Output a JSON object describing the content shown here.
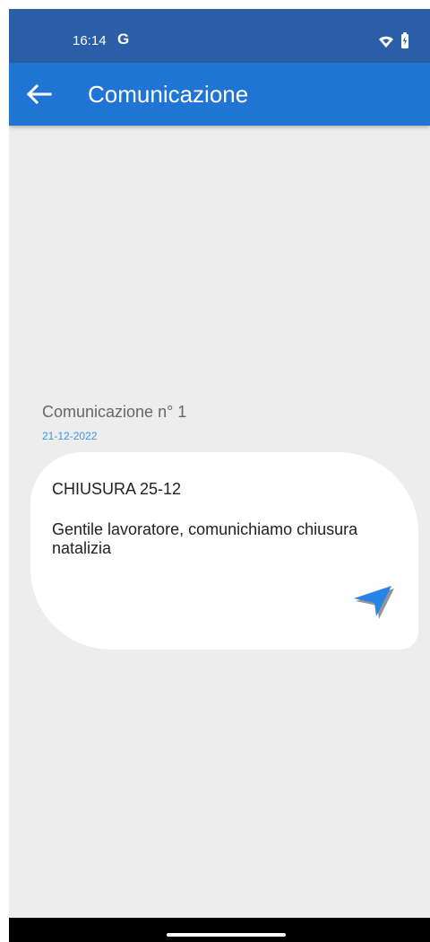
{
  "status_bar": {
    "time": "16:14",
    "google_glyph": "G",
    "icons": [
      "wifi-icon",
      "battery-charging-icon"
    ]
  },
  "app_bar": {
    "title": "Comunicazione",
    "back_icon": "arrow-left-icon",
    "color": "#1f74d4"
  },
  "communication": {
    "heading": "Comunicazione n° 1",
    "date": "21-12-2022",
    "title": "CHIUSURA 25-12",
    "body": "Gentile lavoratore, comunichiamo chiusura natalizia",
    "action_icon": "send-icon"
  },
  "colors": {
    "status_bar": "#2a5fa8",
    "background": "#ededed",
    "accent": "#3298e8",
    "card": "#ffffff"
  }
}
